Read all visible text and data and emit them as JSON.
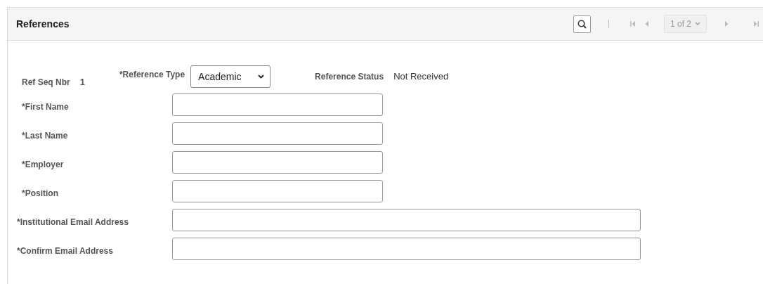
{
  "section": {
    "title": "References"
  },
  "pager": {
    "nav_buttons": [
      {
        "kind": "first",
        "disabled": true
      },
      {
        "kind": "previous",
        "disabled": true
      },
      {
        "kind": "next",
        "disabled": true
      },
      {
        "kind": "last",
        "disabled": true
      }
    ],
    "page_select": "1 of 2"
  },
  "ref_seq": {
    "label": "Ref Seq Nbr",
    "value": "1"
  },
  "reference_type": {
    "label": "*Reference Type",
    "value": "Academic"
  },
  "reference_status": {
    "label": "Reference Status",
    "value": "Not Received"
  },
  "fields": [
    {
      "label": "*First Name",
      "kind": "short"
    },
    {
      "label": "*Last Name",
      "kind": "short"
    },
    {
      "label": "*Employer",
      "kind": "short"
    },
    {
      "label": "*Position",
      "kind": "short"
    },
    {
      "label": "*Institutional Email Address",
      "kind": "long"
    },
    {
      "label": "*Confirm Email Address",
      "kind": "long"
    }
  ]
}
